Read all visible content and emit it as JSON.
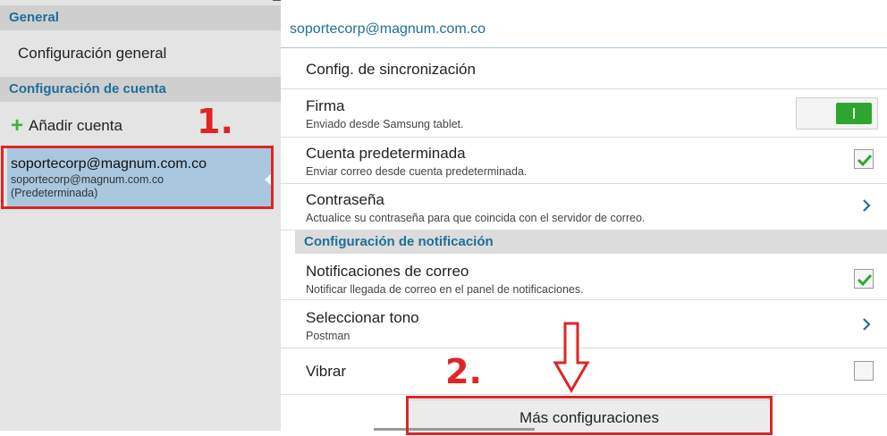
{
  "left": {
    "general_header": "General",
    "general_item": "Configuración general",
    "account_header": "Configuración de cuenta",
    "add_account": "Añadir cuenta",
    "account": {
      "email": "soportecorp@magnum.com.co",
      "sub_email": "soportecorp@magnum.com.co",
      "sub_default": "(Predeterminada)"
    }
  },
  "right": {
    "account_title": "soportecorp@magnum.com.co",
    "sync": {
      "title": "Config. de sincronización"
    },
    "signature": {
      "title": "Firma",
      "summary": "Enviado desde Samsung tablet.",
      "enabled": true
    },
    "default_account": {
      "title": "Cuenta predeterminada",
      "summary": "Enviar correo desde cuenta predeterminada.",
      "checked": true
    },
    "password": {
      "title": "Contraseña",
      "summary": "Actualice su contraseña para que coincida con el servidor de correo."
    },
    "notif_header": "Configuración de notificación",
    "mail_notifications": {
      "title": "Notificaciones de correo",
      "summary": "Notificar llegada de correo en el panel de notificaciones.",
      "checked": true
    },
    "ringtone": {
      "title": "Seleccionar tono",
      "summary": "Postman"
    },
    "vibrate": {
      "title": "Vibrar",
      "checked": false
    },
    "more_settings": "Más configuraciones"
  },
  "annotations": {
    "step1": "1.",
    "step2": "2."
  },
  "colors": {
    "accent": "#1f6f99",
    "selected": "#a9c7df",
    "check": "#2fa52f",
    "annotation": "#e02424"
  }
}
